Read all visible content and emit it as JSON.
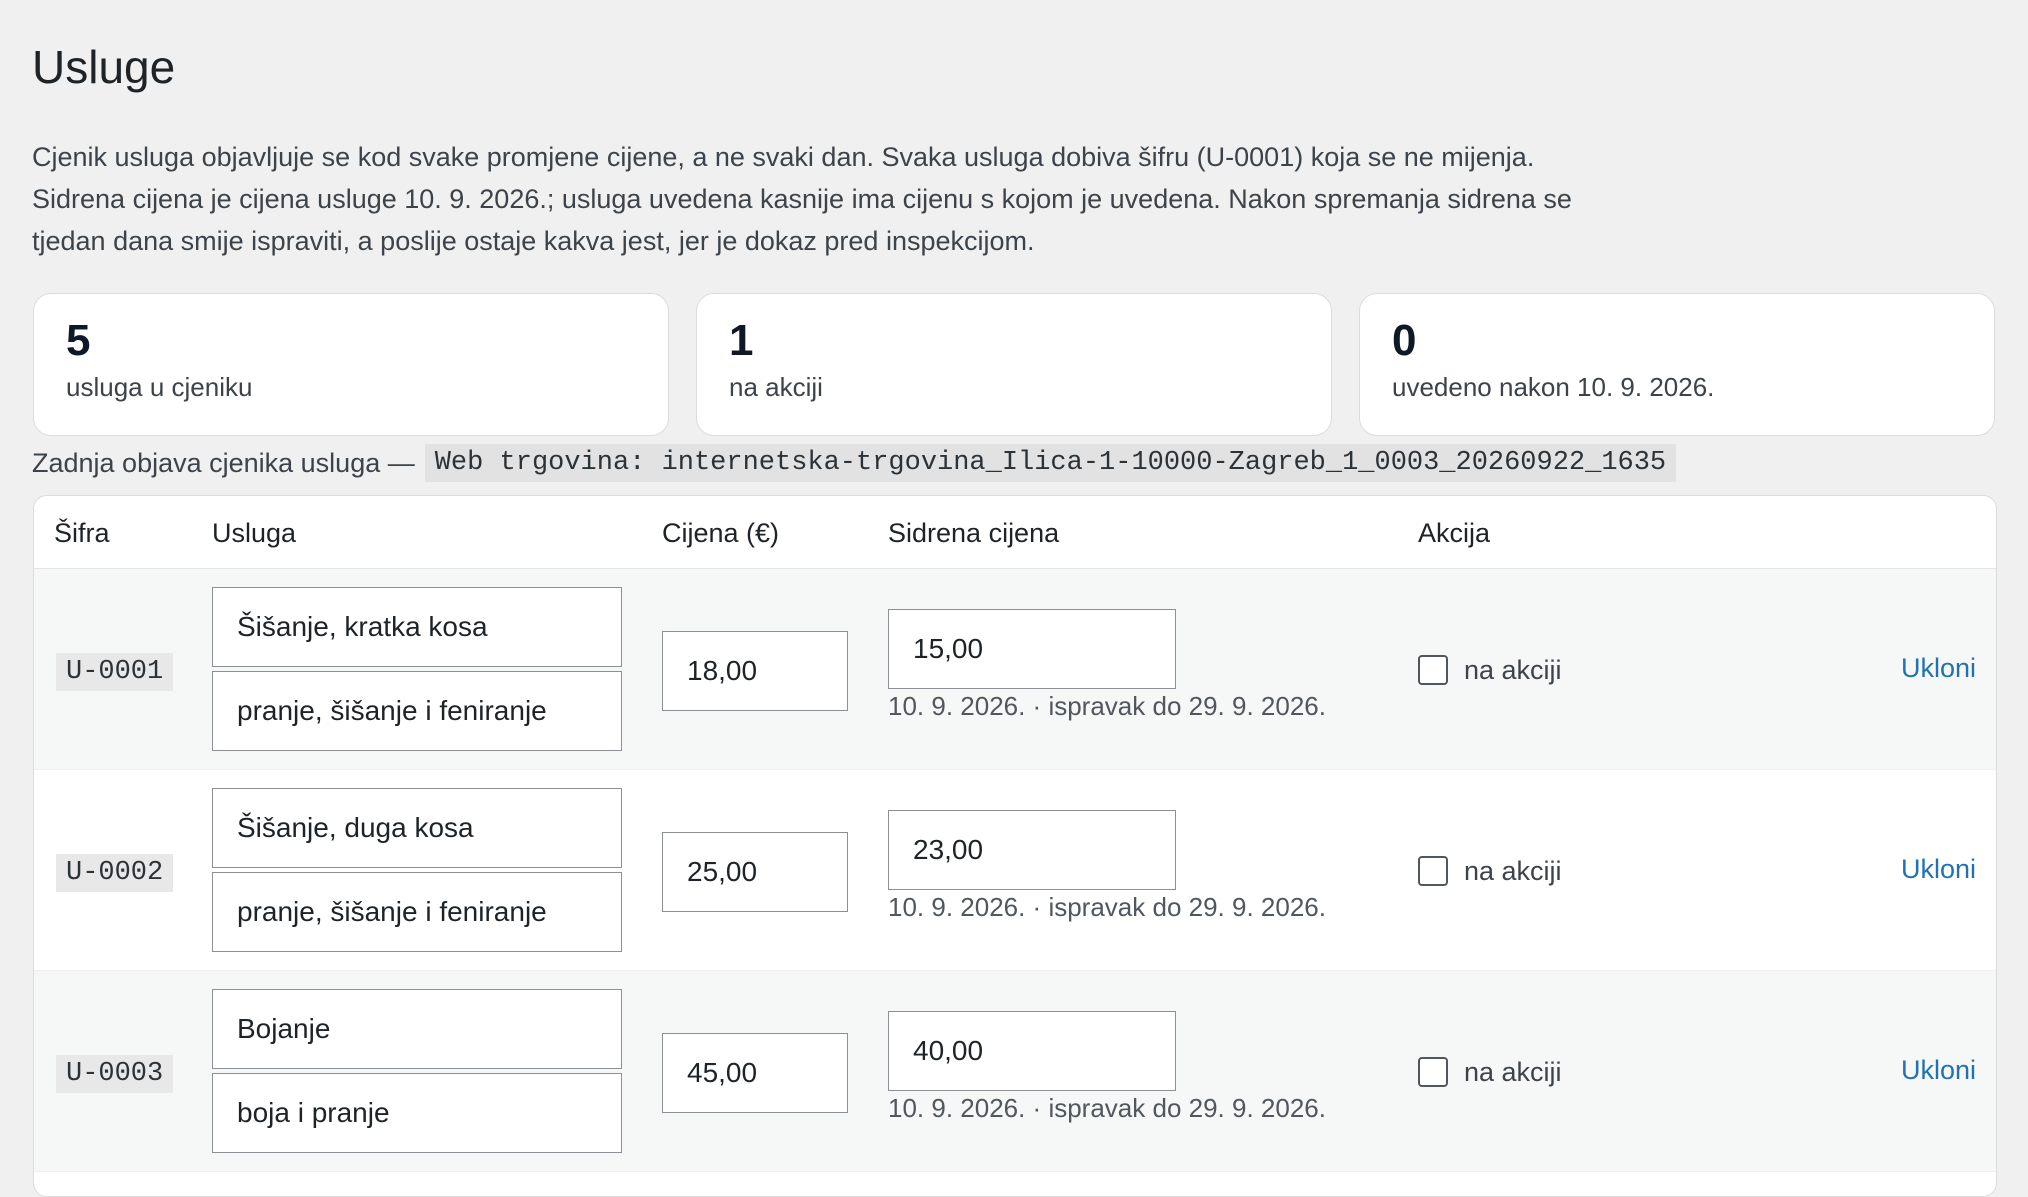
{
  "page": {
    "title": "Usluge",
    "intro": [
      "Cjenik usluga objavljuje se kod svake promjene cijene, a ne svaki dan. Svaka usluga dobiva šifru (U-0001) koja se ne mijenja.",
      "Sidrena cijena je cijena usluge 10. 9. 2026.; usluga uvedena kasnije ima cijenu s kojom je uvedena. Nakon spremanja sidrena se",
      "tjedan dana smije ispraviti, a poslije ostaje kakva jest, jer je dokaz pred inspekcijom."
    ]
  },
  "stats": [
    {
      "value": "5",
      "label": "usluga u cjeniku"
    },
    {
      "value": "1",
      "label": "na akciji"
    },
    {
      "value": "0",
      "label": "uvedeno nakon 10. 9. 2026."
    }
  ],
  "last_publication": {
    "label": "Zadnja objava cjenika usluga —",
    "code": "Web trgovina: internetska-trgovina_Ilica-1-10000-Zagreb_1_0003_20260922_1635"
  },
  "table": {
    "headers": {
      "sifra": "Šifra",
      "usluga": "Usluga",
      "cijena": "Cijena (€)",
      "sidrena": "Sidrena cijena",
      "akcija": "Akcija"
    },
    "rows": [
      {
        "sifra": "U-0001",
        "name": "Šišanje, kratka kosa",
        "desc": "pranje, šišanje i feniranje",
        "price": "18,00",
        "anchor": "15,00",
        "anchor_note": "10. 9. 2026. · ispravak do 29. 9. 2026.",
        "promo_label": "na akciji",
        "remove_label": "Ukloni"
      },
      {
        "sifra": "U-0002",
        "name": "Šišanje, duga kosa",
        "desc": "pranje, šišanje i feniranje",
        "price": "25,00",
        "anchor": "23,00",
        "anchor_note": "10. 9. 2026. · ispravak do 29. 9. 2026.",
        "promo_label": "na akciji",
        "remove_label": "Ukloni"
      },
      {
        "sifra": "U-0003",
        "name": "Bojanje",
        "desc": "boja i pranje",
        "price": "45,00",
        "anchor": "40,00",
        "anchor_note": "10. 9. 2026. · ispravak do 29. 9. 2026.",
        "promo_label": "na akciji",
        "remove_label": "Ukloni"
      }
    ]
  }
}
